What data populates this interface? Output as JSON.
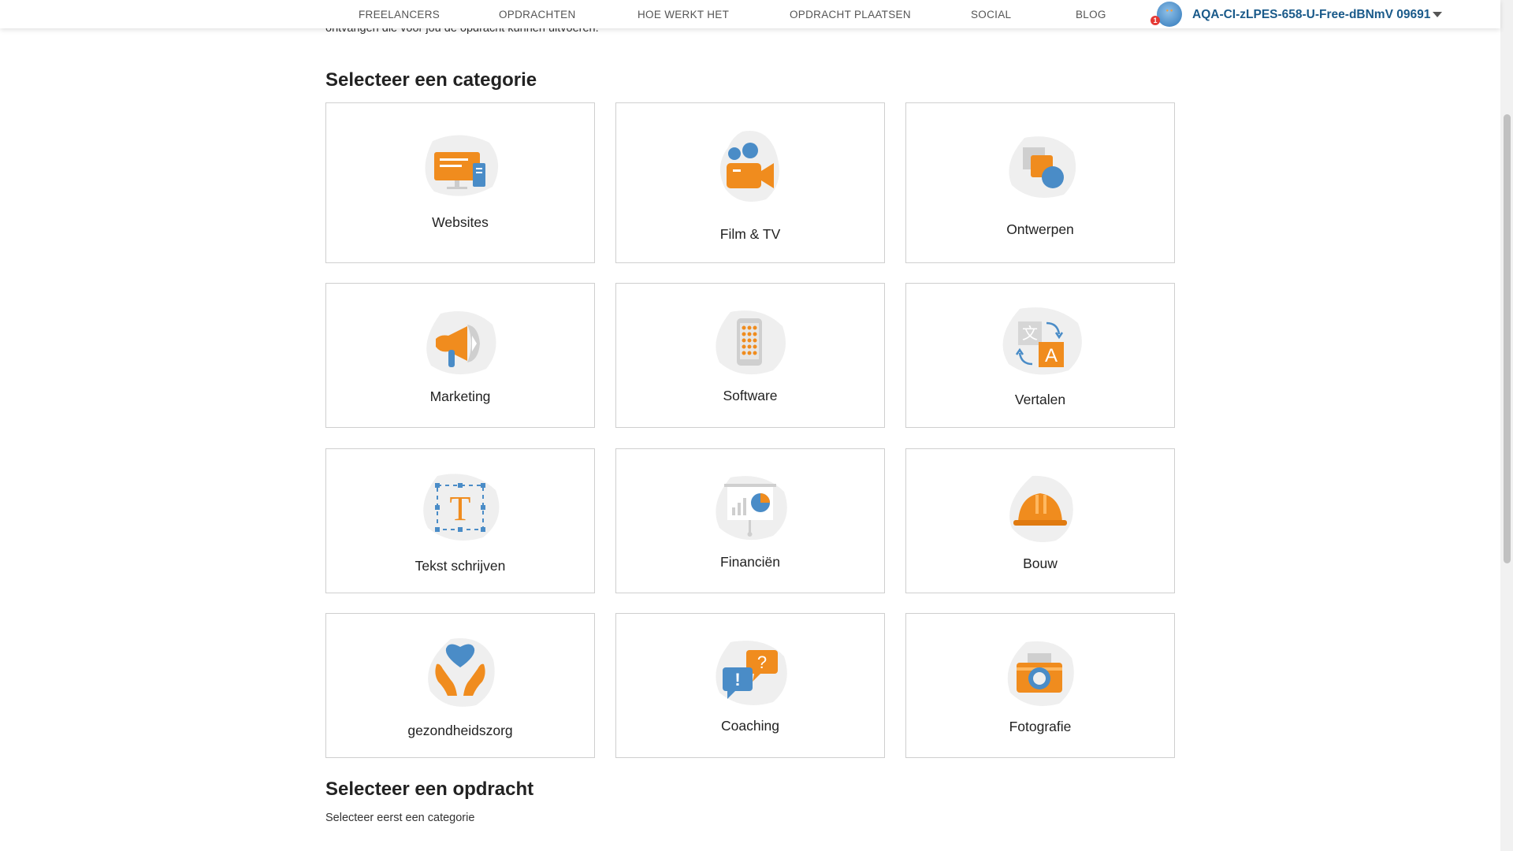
{
  "nav": {
    "links": [
      "FREELANCERS",
      "OPDRACHTEN",
      "HOE WERKT HET",
      "OPDRACHT PLAATSEN",
      "SOCIAL",
      "BLOG"
    ],
    "user": {
      "name": "AQA-CI-zLPES-658-U-Free-dBNmV 09691",
      "notification_count": "1"
    }
  },
  "intro_partial": "ontvangen die voor jou de opdracht kunnen uitvoeren.",
  "categories_title": "Selecteer een categorie",
  "categories": [
    {
      "label": "Websites",
      "icon": "websites-icon"
    },
    {
      "label": "Film & TV",
      "icon": "film-tv-icon"
    },
    {
      "label": "Ontwerpen",
      "icon": "design-icon"
    },
    {
      "label": "Marketing",
      "icon": "megaphone-icon"
    },
    {
      "label": "Software",
      "icon": "mobile-app-icon"
    },
    {
      "label": "Vertalen",
      "icon": "translate-icon"
    },
    {
      "label": "Tekst schrijven",
      "icon": "text-icon"
    },
    {
      "label": "Financiën",
      "icon": "presentation-chart-icon"
    },
    {
      "label": "Bouw",
      "icon": "hard-hat-icon"
    },
    {
      "label": "gezondheidszorg",
      "icon": "heart-hands-icon"
    },
    {
      "label": "Coaching",
      "icon": "chat-bubbles-icon"
    },
    {
      "label": "Fotografie",
      "icon": "camera-icon"
    }
  ],
  "assignments_title": "Selecteer een opdracht",
  "assignments_helper": "Selecteer eerst een categorie",
  "colors": {
    "accent": "#F08C1E",
    "blue": "#4A8CC7",
    "blob": "#EFEFEF"
  }
}
